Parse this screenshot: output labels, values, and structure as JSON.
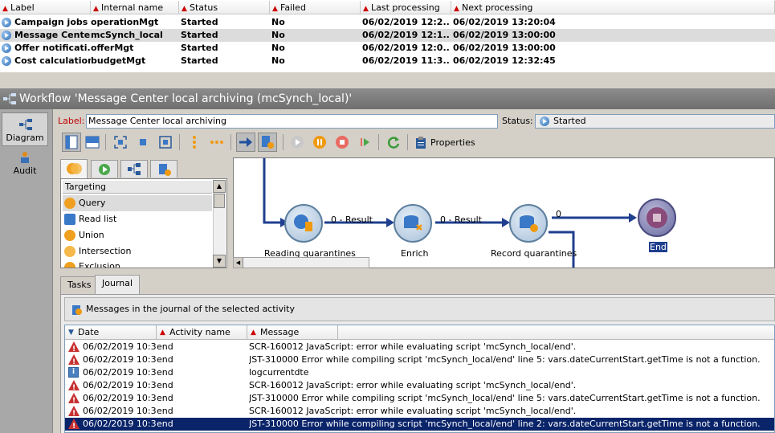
{
  "top_list": {
    "columns": [
      "Label",
      "Internal name",
      "Status",
      "Failed",
      "Last processing",
      "Next processing"
    ],
    "rows": [
      {
        "label": "Campaign jobs",
        "internal": "operationMgt",
        "status": "Started",
        "failed": "No",
        "last": "06/02/2019 12:2...",
        "next": "06/02/2019 13:20:04"
      },
      {
        "label": "Message Cente...",
        "internal": "mcSynch_local",
        "status": "Started",
        "failed": "No",
        "last": "06/02/2019 12:1...",
        "next": "06/02/2019 13:00:00"
      },
      {
        "label": "Offer notificati...",
        "internal": "offerMgt",
        "status": "Started",
        "failed": "No",
        "last": "06/02/2019 12:0...",
        "next": "06/02/2019 13:00:00"
      },
      {
        "label": "Cost calculation",
        "internal": "budgetMgt",
        "status": "Started",
        "failed": "No",
        "last": "06/02/2019 11:3...",
        "next": "06/02/2019 12:32:45"
      }
    ]
  },
  "workflow": {
    "title": "Workflow 'Message Center local archiving (mcSynch_local)'",
    "label_caption": "Label:",
    "label_value": "Message Center local archiving",
    "status_caption": "Status:",
    "status_value": "Started"
  },
  "left_nav": [
    {
      "label": "Diagram",
      "icon": "diagram-icon"
    },
    {
      "label": "Audit",
      "icon": "audit-icon"
    }
  ],
  "toolbar": {
    "properties_label": "Properties"
  },
  "palette": {
    "category": "Targeting",
    "items": [
      "Query",
      "Read list",
      "Union",
      "Intersection",
      "Exclusion"
    ]
  },
  "diagram": {
    "nodes": [
      "Reading quarantines",
      "Enrich",
      "Record quarantines",
      "End"
    ],
    "transitions": [
      "0 - Result",
      "0 - Result",
      "0"
    ]
  },
  "bottom_tabs": [
    "Tasks",
    "Journal"
  ],
  "journal": {
    "header": "Messages in the journal of the selected activity",
    "columns": [
      "Date",
      "Activity name",
      "Message"
    ],
    "rows": [
      {
        "type": "error",
        "date": "06/02/2019 10:3...",
        "activity": "end",
        "message": "SCR-160012 JavaScript: error while evaluating script 'mcSynch_local/end'."
      },
      {
        "type": "error",
        "date": "06/02/2019 10:3...",
        "activity": "end",
        "message": "JST-310000 Error while compiling script 'mcSynch_local/end' line 5: vars.dateCurrentStart.getTime is not a function."
      },
      {
        "type": "info",
        "date": "06/02/2019 10:3...",
        "activity": "end",
        "message": "logcurrentdte"
      },
      {
        "type": "error",
        "date": "06/02/2019 10:3...",
        "activity": "end",
        "message": "SCR-160012 JavaScript: error while evaluating script 'mcSynch_local/end'."
      },
      {
        "type": "error",
        "date": "06/02/2019 10:3...",
        "activity": "end",
        "message": "JST-310000 Error while compiling script 'mcSynch_local/end' line 5: vars.dateCurrentStart.getTime is not a function."
      },
      {
        "type": "error",
        "date": "06/02/2019 10:3...",
        "activity": "end",
        "message": "SCR-160012 JavaScript: error while evaluating script 'mcSynch_local/end'."
      },
      {
        "type": "error",
        "date": "06/02/2019 10:3...",
        "activity": "end",
        "message": "JST-310000 Error while compiling script 'mcSynch_local/end' line 2: vars.dateCurrentStart.getTime is not a function."
      }
    ]
  }
}
